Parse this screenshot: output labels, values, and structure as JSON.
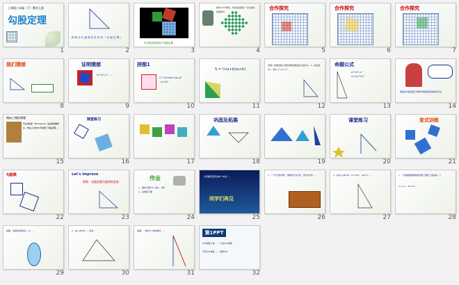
{
  "slides": [
    {
      "n": "1",
      "title": "勾股定理",
      "sub": "上海版八年级（下）数学上册"
    },
    {
      "n": "2",
      "caption": "称 斜 边 与 直 角 边 的 关 系 （ 勾 股 定 理 ）"
    },
    {
      "n": "3",
      "caption": "毕达哥拉斯发现了勾股定理"
    },
    {
      "n": "4"
    },
    {
      "n": "5",
      "label": "合作探究"
    },
    {
      "n": "6",
      "label": "合作探究"
    },
    {
      "n": "7",
      "label": "合作探究"
    },
    {
      "n": "8",
      "label": "我们猜想"
    },
    {
      "n": "9",
      "label": "证明猜想"
    },
    {
      "n": "10",
      "label": "拼图1"
    },
    {
      "n": "11",
      "formula": "S = ½(a+b)(a+b)"
    },
    {
      "n": "12"
    },
    {
      "n": "13",
      "label": "命题公式"
    },
    {
      "n": "14"
    },
    {
      "n": "15",
      "heading": "相似三角形原理"
    },
    {
      "n": "16",
      "label": "随堂练习"
    },
    {
      "n": "17"
    },
    {
      "n": "18",
      "label": "巩固及拓展"
    },
    {
      "n": "19"
    },
    {
      "n": "20",
      "label": "课堂练习"
    },
    {
      "n": "21",
      "label": "变式训练"
    },
    {
      "n": "22",
      "label": "勾股数"
    },
    {
      "n": "23",
      "label": "Let's Improve"
    },
    {
      "n": "24",
      "label": "作业"
    },
    {
      "n": "25",
      "text": "同学们再见"
    },
    {
      "n": "26"
    },
    {
      "n": "27"
    },
    {
      "n": "28"
    },
    {
      "n": "29"
    },
    {
      "n": "30"
    },
    {
      "n": "31"
    },
    {
      "n": "32",
      "logo": "第1PPT"
    }
  ],
  "colors": {
    "accent": "#1b2a88",
    "red": "#c80000",
    "grid": "#6d8ab8",
    "navy": "#0b3a7a"
  }
}
